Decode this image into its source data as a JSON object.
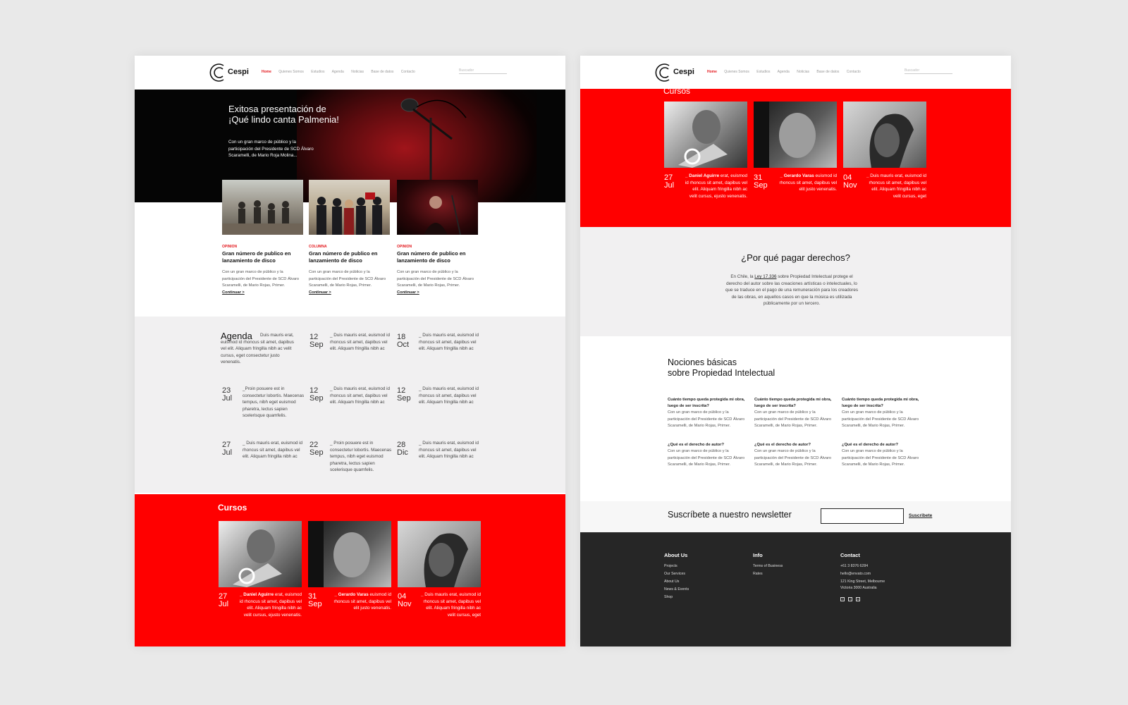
{
  "site": {
    "brand": "Cespi",
    "nav": [
      "Home",
      "Quienes Somos",
      "Estudios",
      "Agenda",
      "Noticias",
      "Base de datos",
      "Contacto"
    ],
    "search_placeholder": "Buscador"
  },
  "hero": {
    "title": "Exitosa presentación de ¡Qué lindo canta Palmenia!",
    "text": "Con un gran marco de público y la participación del Presidente de SCD Álvaro Scaramelli, de Mario Roja Molina..."
  },
  "cards": [
    {
      "category": "OPINION",
      "title": "Gran número de publico en lanzamiento de disco",
      "text": "Con un gran marco de público y la participación del Presidente de SCD Álvaro Scaramelli, de Mario Rojas, Primer.",
      "link": "Continuar >"
    },
    {
      "category": "COLUMNA",
      "title": "Gran número de publico en lanzamiento de disco",
      "text": "Con un gran marco de público y la participación del Presidente de SCD Álvaro Scaramelli, de Mario Rojas, Primer.",
      "link": "Continuar >"
    },
    {
      "category": "OPINION",
      "title": "Gran número de publico en lanzamiento de disco",
      "text": "Con un gran marco de público y la participación del Presidente de SCD Álvaro Scaramelli, de Mario Rojas, Primer.",
      "link": "Continuar >"
    }
  ],
  "agenda": {
    "title": "Agenda",
    "lead": "Duis mauris erat, euismod id rhoncus sit amet, dapibus vel elit. Aliquam fringilla nibh ac velit cursus, eget consectetur justo venenatis.",
    "events": [
      {
        "day": "12",
        "month": "Sep",
        "text": "_ Duis mauris erat, euismod id rhoncus sit amet, dapibus vel elit. Aliquam fringilla nibh ac"
      },
      {
        "day": "18",
        "month": "Oct",
        "text": "_ Duis mauris erat, euismod id rhoncus sit amet, dapibus vel elit. Aliquam fringilla nibh ac"
      },
      {
        "day": "23",
        "month": "Jul",
        "text": "_Proin posuere est in consectetur lobortis. Maecenas tempus, nibh eget euismod pharetra, lectus sapien scelerisque quamfelis."
      },
      {
        "day": "12",
        "month": "Sep",
        "text": "_ Duis mauris erat, euismod id rhoncus sit amet, dapibus vel elit. Aliquam fringilla nibh ac"
      },
      {
        "day": "12",
        "month": "Sep",
        "text": "_ Duis mauris erat, euismod id rhoncus sit amet, dapibus vel elit. Aliquam fringilla nibh ac"
      },
      {
        "day": "27",
        "month": "Jul",
        "text": "_ Duis mauris erat, euismod id rhoncus sit amet, dapibus vel elit. Aliquam fringilla nibh ac"
      },
      {
        "day": "22",
        "month": "Sep",
        "text": "_ Proin posuere est in consectetur lobortis. Maecenas tempus, nibh eget euismod pharetra, lectus sapien scelerisque quamfelis."
      },
      {
        "day": "28",
        "month": "Dic",
        "text": "_ Duis mauris erat, euismod id rhoncus sit amet, dapibus vel elit. Aliquam fringilla nibh ac"
      }
    ]
  },
  "cursos": {
    "title": "Cursos",
    "items": [
      {
        "day": "27",
        "month": "Jul",
        "name": "_ Daniel Aguirre",
        "text": "erat, euismod id rhoncus sit amet, dapibus vel elit. Aliquam fringilla nibh ac velit cursus, ejusto venenatis."
      },
      {
        "day": "31",
        "month": "Sep",
        "name": "_ Gerardo Varas",
        "text": "euismod id rhoncus sit amet, dapibus vel elit justo venenatis."
      },
      {
        "day": "04",
        "month": "Nov",
        "name": "_",
        "text": "Duis mauris erat, euismod id rhoncus sit amet, dapibus vel elit. Aliquam fringilla nibh ac velit cursus, eget"
      }
    ]
  },
  "porque": {
    "title": "¿Por qué pagar derechos?",
    "text_before": "En Chile, la ",
    "law": "Ley 17.336",
    "text_after": " sobre Propiedad Intelectual protege el derecho del autor sobre las creaciones artísticas o intelectuales, lo que se traduce en el pago de una remuneración para los creadores de las obras, en aquellos casos en que la música es utilizada públicamente por un tercero."
  },
  "nociones": {
    "title_line1": "Nociones básicas",
    "title_line2": "sobre Propiedad Intelectual",
    "faqs": [
      {
        "q": "Cuánto tiempo queda protegida mi obra, luego de ser inscrita?",
        "a": "Con un gran marco de público y la participación del Presidente de SCD Álvaro Scaramelli, de Mario Rojas, Primer."
      },
      {
        "q": "Cuánto tiempo queda protegida mi obra, luego de ser inscrita?",
        "a": "Con un gran marco de público y la participación del Presidente de SCD Álvaro Scaramelli, de Mario Rojas, Primer."
      },
      {
        "q": "Cuánto tiempo queda protegida mi obra, luego de ser inscrita?",
        "a": "Con un gran marco de público y la participación del Presidente de SCD Álvaro Scaramelli, de Mario Rojas, Primer."
      },
      {
        "q": "¿Qué es el derecho de autor?",
        "a": "Con un gran marco de público y la participación del Presidente de SCD Álvaro Scaramelli, de Mario Rojas, Primer."
      },
      {
        "q": "¿Qué es el derecho de autor?",
        "a": "Con un gran marco de público y la participación del Presidente de SCD Álvaro Scaramelli, de Mario Rojas, Primer."
      },
      {
        "q": "¿Qué es el derecho de autor?",
        "a": "Con un gran marco de público y la participación del Presidente de SCD Álvaro Scaramelli, de Mario Rojas, Primer."
      }
    ]
  },
  "newsletter": {
    "label": "Suscríbete a nuestro newsletter",
    "button": "Suscribete"
  },
  "footer": {
    "about_title": "About Us",
    "about_links": [
      "Projects",
      "Our Services",
      "About Us",
      "News & Events",
      "Shop"
    ],
    "info_title": "Info",
    "info_links": [
      "Terms of Business",
      "Rates"
    ],
    "contact_title": "Contact",
    "contact_lines": [
      "+61 3 8376 6284",
      "hello@envato.com",
      "121 King Street, Melbourne",
      "Victoria 3000 Australia"
    ],
    "social_icons": [
      "facebook-icon",
      "twitter-icon",
      "instagram-icon"
    ]
  },
  "colors": {
    "accent": "#ff0000",
    "nav_active": "#e3171c",
    "footer": "#262626",
    "light_section": "#f1f0f1"
  }
}
